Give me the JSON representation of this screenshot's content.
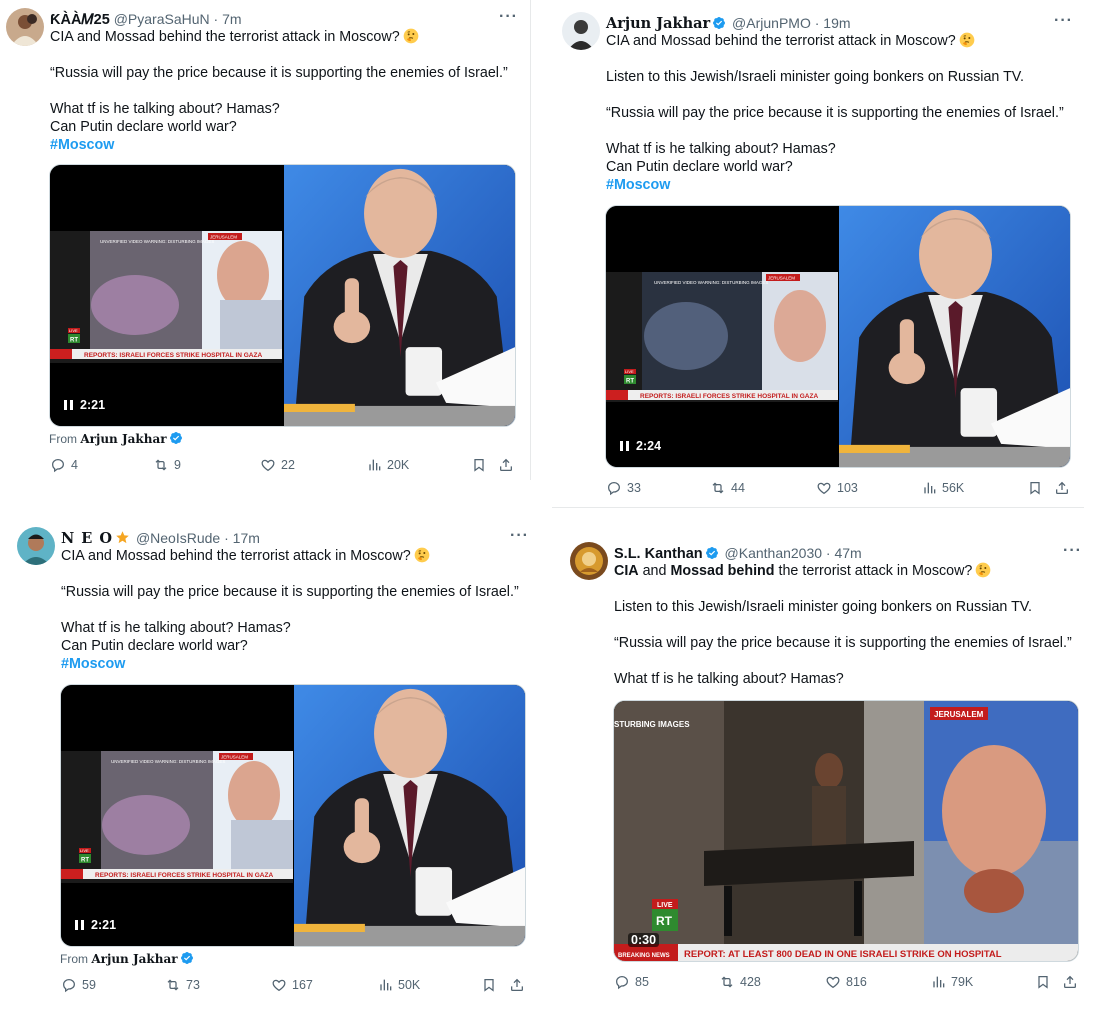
{
  "tweets": [
    {
      "name": "ƘÀÀ𝑀25",
      "handle": "@PyaraSaHuN",
      "time": "7m",
      "line1": "CIA and Mossad behind the terrorist attack in Moscow?",
      "quote": "“Russia will pay the price because it is supporting the enemies of Israel.”",
      "line3": "What tf is he talking about? Hamas?",
      "line4": "Can Putin declare world war?",
      "hashtag": "#Moscow",
      "video": {
        "duration": "2:21",
        "chyron": "REPORTS: ISRAELI FORCES STRIKE HOSPITAL IN GAZA",
        "warning": "UNVERIFIED VIDEO WARNING: DISTURBING IMAGES",
        "location": "JERUSALEM",
        "live": "LIVE",
        "logo": "RT",
        "breaking": "BREAKING NEWS"
      },
      "from_label": "From",
      "from_name": "Arjun Jakhar",
      "stats": {
        "replies": "4",
        "reposts": "9",
        "likes": "22",
        "views": "20K"
      }
    },
    {
      "name": "Arjun Jakhar",
      "handle": "@ArjunPMO",
      "time": "19m",
      "line1": "CIA and Mossad behind the terrorist attack in Moscow?",
      "intro": "Listen to this Jewish/Israeli minister going bonkers on Russian TV.",
      "quote": "“Russia will pay the price because it is supporting the enemies of Israel.”",
      "line3": "What tf is he talking about? Hamas?",
      "line4": "Can Putin declare world war?",
      "hashtag": "#Moscow",
      "video": {
        "duration": "2:24",
        "chyron": "REPORTS: ISRAELI FORCES STRIKE HOSPITAL IN GAZA",
        "warning": "UNVERIFIED VIDEO WARNING: DISTURBING IMAGES",
        "location": "JERUSALEM",
        "live": "LIVE",
        "logo": "RT",
        "breaking": "BREAKING NEWS"
      },
      "stats": {
        "replies": "33",
        "reposts": "44",
        "likes": "103",
        "views": "56K"
      }
    },
    {
      "name": "N E O",
      "handle": "@NeoIsRude",
      "time": "17m",
      "line1": "CIA and Mossad behind the terrorist attack in Moscow?",
      "quote": "“Russia will pay the price because it is supporting the enemies of Israel.”",
      "line3": "What tf is he talking about? Hamas?",
      "line4": "Can Putin declare world war?",
      "hashtag": "#Moscow",
      "video": {
        "duration": "2:21",
        "chyron": "REPORTS: ISRAELI FORCES STRIKE HOSPITAL IN GAZA",
        "warning": "UNVERIFIED VIDEO WARNING: DISTURBING IMAGES",
        "location": "JERUSALEM",
        "live": "LIVE",
        "logo": "RT",
        "breaking": "BREAKING NEWS"
      },
      "from_label": "From",
      "from_name": "Arjun Jakhar",
      "stats": {
        "replies": "59",
        "reposts": "73",
        "likes": "167",
        "views": "50K"
      }
    },
    {
      "name": "S.L. Kanthan",
      "handle": "@Kanthan2030",
      "time": "47m",
      "line1_a": "CIA",
      "line1_b": "and",
      "line1_c": "Mossad behind",
      "line1_d": "the terrorist attack in Moscow?",
      "intro": "Listen to this Jewish/Israeli minister going bonkers on Russian TV.",
      "quote": "“Russia will pay the price because it is supporting the enemies of Israel.”",
      "line3": "What tf is he talking about? Hamas?",
      "video": {
        "duration": "0:30",
        "chyron": "REPORT: AT LEAST 800 DEAD IN ONE ISRAELI STRIKE ON HOSPITAL",
        "warning": "STURBING IMAGES",
        "location": "JERUSALEM",
        "live": "LIVE",
        "logo": "RT",
        "breaking": "BREAKING NEWS"
      },
      "stats": {
        "replies": "85",
        "reposts": "428",
        "likes": "816",
        "views": "79K"
      }
    }
  ],
  "ui": {
    "dot": "·",
    "more": "···"
  },
  "colors": {
    "link": "#1d9bf0",
    "muted": "#536471",
    "verified": "#1d9bf0",
    "text": "#0f1419"
  }
}
